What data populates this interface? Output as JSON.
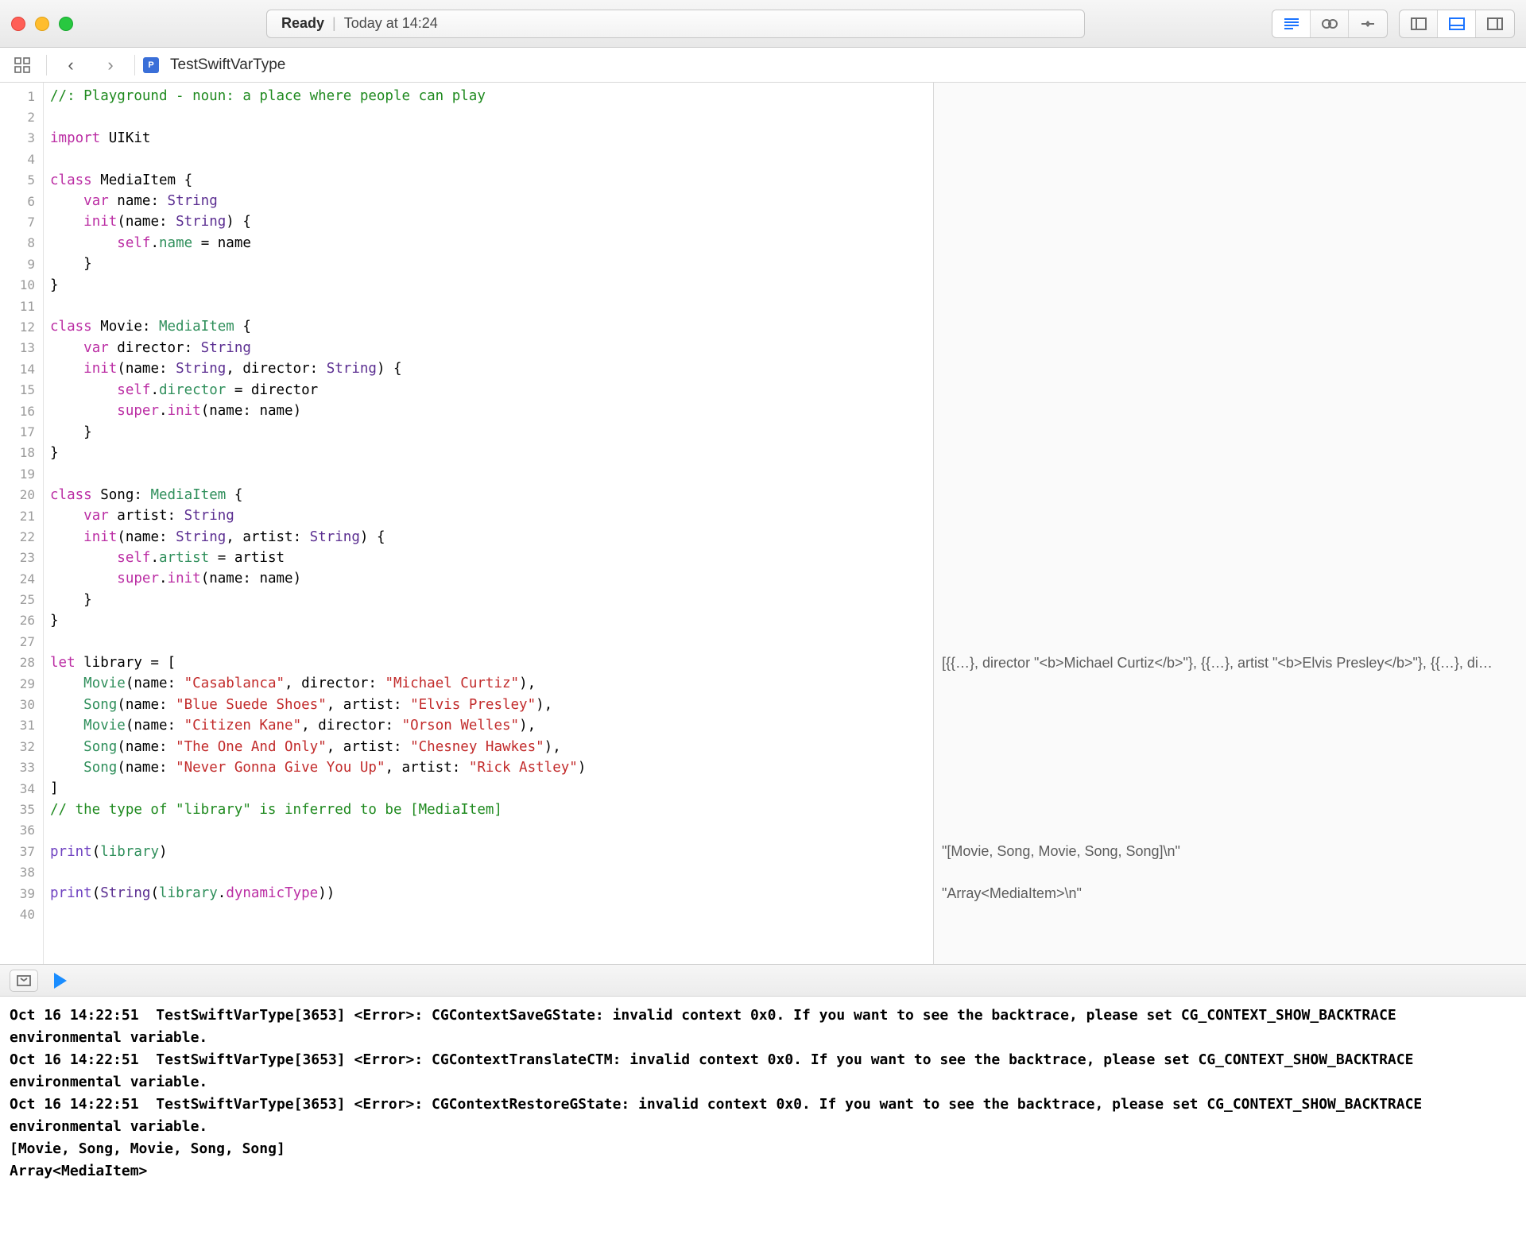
{
  "titlebar": {
    "status_label": "Ready",
    "status_time": "Today at 14:24"
  },
  "pathbar": {
    "filename": "TestSwiftVarType"
  },
  "code_lines": [
    {
      "n": 1,
      "html": "<span class='cmt'>//: Playground - noun: a place where people can play</span>"
    },
    {
      "n": 2,
      "html": ""
    },
    {
      "n": 3,
      "html": "<span class='kw'>import</span> UIKit"
    },
    {
      "n": 4,
      "html": ""
    },
    {
      "n": 5,
      "html": "<span class='kw'>class</span> MediaItem {"
    },
    {
      "n": 6,
      "html": "    <span class='kw'>var</span> name: <span class='typeSys'>String</span>"
    },
    {
      "n": 7,
      "html": "    <span class='kw'>init</span>(name: <span class='typeSys'>String</span>) {"
    },
    {
      "n": 8,
      "html": "        <span class='kw'>self</span>.<span class='prop'>name</span> = name"
    },
    {
      "n": 9,
      "html": "    }"
    },
    {
      "n": 10,
      "html": "}"
    },
    {
      "n": 11,
      "html": ""
    },
    {
      "n": 12,
      "html": "<span class='kw'>class</span> Movie: <span class='prop'>MediaItem</span> {"
    },
    {
      "n": 13,
      "html": "    <span class='kw'>var</span> director: <span class='typeSys'>String</span>"
    },
    {
      "n": 14,
      "html": "    <span class='kw'>init</span>(name: <span class='typeSys'>String</span>, director: <span class='typeSys'>String</span>) {"
    },
    {
      "n": 15,
      "html": "        <span class='kw'>self</span>.<span class='prop'>director</span> = director"
    },
    {
      "n": 16,
      "html": "        <span class='kw'>super</span>.<span class='kw'>init</span>(name: name)"
    },
    {
      "n": 17,
      "html": "    }"
    },
    {
      "n": 18,
      "html": "}"
    },
    {
      "n": 19,
      "html": ""
    },
    {
      "n": 20,
      "html": "<span class='kw'>class</span> Song: <span class='prop'>MediaItem</span> {"
    },
    {
      "n": 21,
      "html": "    <span class='kw'>var</span> artist: <span class='typeSys'>String</span>"
    },
    {
      "n": 22,
      "html": "    <span class='kw'>init</span>(name: <span class='typeSys'>String</span>, artist: <span class='typeSys'>String</span>) {"
    },
    {
      "n": 23,
      "html": "        <span class='kw'>self</span>.<span class='prop'>artist</span> = artist"
    },
    {
      "n": 24,
      "html": "        <span class='kw'>super</span>.<span class='kw'>init</span>(name: name)"
    },
    {
      "n": 25,
      "html": "    }"
    },
    {
      "n": 26,
      "html": "}"
    },
    {
      "n": 27,
      "html": ""
    },
    {
      "n": 28,
      "html": "<span class='kw'>let</span> library = ["
    },
    {
      "n": 29,
      "html": "    <span class='prop'>Movie</span>(name: <span class='str'>\"Casablanca\"</span>, director: <span class='str'>\"Michael Curtiz\"</span>),"
    },
    {
      "n": 30,
      "html": "    <span class='prop'>Song</span>(name: <span class='str'>\"Blue Suede Shoes\"</span>, artist: <span class='str'>\"Elvis Presley\"</span>),"
    },
    {
      "n": 31,
      "html": "    <span class='prop'>Movie</span>(name: <span class='str'>\"Citizen Kane\"</span>, director: <span class='str'>\"Orson Welles\"</span>),"
    },
    {
      "n": 32,
      "html": "    <span class='prop'>Song</span>(name: <span class='str'>\"The One And Only\"</span>, artist: <span class='str'>\"Chesney Hawkes\"</span>),"
    },
    {
      "n": 33,
      "html": "    <span class='prop'>Song</span>(name: <span class='str'>\"Never Gonna Give You Up\"</span>, artist: <span class='str'>\"Rick Astley\"</span>)"
    },
    {
      "n": 34,
      "html": "]"
    },
    {
      "n": 35,
      "html": "<span class='cmt'>// the type of \"library\" is inferred to be [MediaItem]</span>"
    },
    {
      "n": 36,
      "html": ""
    },
    {
      "n": 37,
      "html": "<span class='type'>print</span>(<span class='prop'>library</span>)"
    },
    {
      "n": 38,
      "html": ""
    },
    {
      "n": 39,
      "html": "<span class='type'>print</span>(<span class='typeSys'>String</span>(<span class='prop'>library</span>.<span class='kw'>dynamicType</span>))"
    },
    {
      "n": 40,
      "html": ""
    }
  ],
  "results": {
    "28": "[{{…}, director \"<b>Michael Curtiz</b>\"}, {{…}, artist \"<b>Elvis Presley</b>\"}, {{…}, di…",
    "37": "\"[Movie, Song, Movie, Song, Song]\\n\"",
    "39": "\"Array<MediaItem>\\n\""
  },
  "console_text": "Oct 16 14:22:51  TestSwiftVarType[3653] <Error>: CGContextSaveGState: invalid context 0x0. If you want to see the backtrace, please set CG_CONTEXT_SHOW_BACKTRACE environmental variable.\nOct 16 14:22:51  TestSwiftVarType[3653] <Error>: CGContextTranslateCTM: invalid context 0x0. If you want to see the backtrace, please set CG_CONTEXT_SHOW_BACKTRACE environmental variable.\nOct 16 14:22:51  TestSwiftVarType[3653] <Error>: CGContextRestoreGState: invalid context 0x0. If you want to see the backtrace, please set CG_CONTEXT_SHOW_BACKTRACE environmental variable.\n[Movie, Song, Movie, Song, Song]\nArray<MediaItem>"
}
